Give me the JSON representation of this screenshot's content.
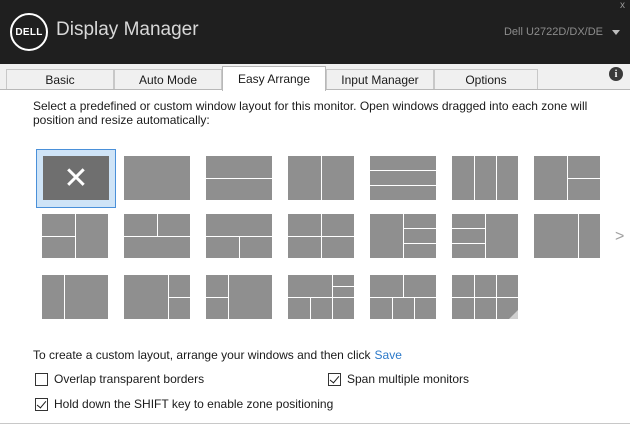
{
  "titlebar": {
    "logo_text": "DELL",
    "title": "Display Manager",
    "close_glyph": "x",
    "monitor": "Dell U2722D/DX/DE"
  },
  "tabs": [
    {
      "label": "Basic",
      "active": false
    },
    {
      "label": "Auto Mode",
      "active": false
    },
    {
      "label": "Easy Arrange",
      "active": true
    },
    {
      "label": "Input Manager",
      "active": false
    },
    {
      "label": "Options",
      "active": false
    }
  ],
  "info_glyph": "i",
  "intro": "Select a predefined or custom window layout for this monitor.  Open windows dragged into each zone will position and resize automatically:",
  "layouts": {
    "selected_glyph": "✕",
    "next_glyph": ">",
    "icons": [
      "close-icon",
      "info-icon",
      "chevron-down-icon",
      "next-arrow-icon"
    ]
  },
  "custom": {
    "text": "To create a custom layout, arrange your windows and then click",
    "save_label": "Save"
  },
  "options": {
    "overlap_label": "Overlap transparent borders",
    "overlap_checked": false,
    "span_label": "Span multiple monitors",
    "span_checked": true,
    "shift_label": "Hold down the SHIFT key to enable zone positioning",
    "shift_checked": true
  },
  "colors": {
    "titlebar": "#1f1f1f",
    "tile": "#8f8f8f",
    "selected_tile": "#6f6f6f",
    "selection_bg": "#cfe4f7",
    "selection_border": "#4a90d9",
    "link": "#2b79c9"
  }
}
